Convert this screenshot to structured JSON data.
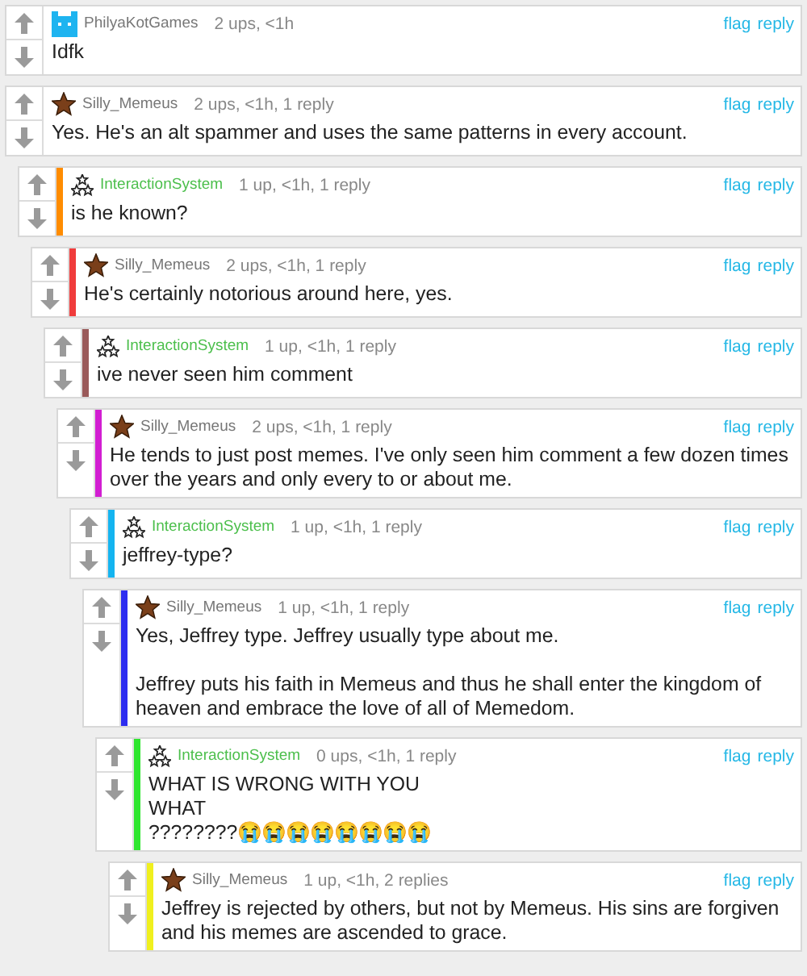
{
  "comments": [
    {
      "author": {
        "name": "PhilyaKotGames",
        "kind": "cat",
        "color": "#777777"
      },
      "meta": "2 ups, <1h",
      "actions": [
        "flag",
        "reply"
      ],
      "paragraphs": [
        [
          "Idfk"
        ]
      ]
    },
    {
      "author": {
        "name": "Silly_Memeus",
        "kind": "star",
        "color": "#777777"
      },
      "meta": "2 ups, <1h, 1 reply",
      "actions": [
        "flag",
        "reply"
      ],
      "paragraphs": [
        [
          "Yes. He's an alt spammer and uses the same patterns in every account."
        ]
      ],
      "children": [
        {
          "author": {
            "name": "InteractionSystem",
            "kind": "stars",
            "color": "#4cbf4c"
          },
          "color": "#ff8c00",
          "meta": "1 up, <1h, 1 reply",
          "actions": [
            "flag",
            "reply"
          ],
          "paragraphs": [
            [
              "is he known?"
            ]
          ],
          "children": [
            {
              "author": {
                "name": "Silly_Memeus",
                "kind": "star",
                "color": "#777777"
              },
              "color": "#f03c3c",
              "meta": "2 ups, <1h, 1 reply",
              "actions": [
                "flag",
                "reply"
              ],
              "paragraphs": [
                [
                  "He's certainly notorious around here, yes."
                ]
              ],
              "children": [
                {
                  "author": {
                    "name": "InteractionSystem",
                    "kind": "stars",
                    "color": "#4cbf4c"
                  },
                  "color": "#9a5a5a",
                  "meta": "1 up, <1h, 1 reply",
                  "actions": [
                    "flag",
                    "reply"
                  ],
                  "paragraphs": [
                    [
                      "ive never seen him comment"
                    ]
                  ],
                  "children": [
                    {
                      "author": {
                        "name": "Silly_Memeus",
                        "kind": "star",
                        "color": "#777777"
                      },
                      "color": "#d21ed2",
                      "meta": "2 ups, <1h, 1 reply",
                      "actions": [
                        "flag",
                        "reply"
                      ],
                      "paragraphs": [
                        [
                          "He tends to just post memes. I've only seen him comment a few dozen times over the years and only every to or about me."
                        ]
                      ],
                      "children": [
                        {
                          "author": {
                            "name": "InteractionSystem",
                            "kind": "stars",
                            "color": "#4cbf4c"
                          },
                          "color": "#14b4f0",
                          "meta": "1 up, <1h, 1 reply",
                          "actions": [
                            "flag",
                            "reply"
                          ],
                          "paragraphs": [
                            [
                              "jeffrey-type?"
                            ]
                          ],
                          "children": [
                            {
                              "author": {
                                "name": "Silly_Memeus",
                                "kind": "star",
                                "color": "#777777"
                              },
                              "color": "#2d2df0",
                              "meta": "1 up, <1h, 1 reply",
                              "actions": [
                                "flag",
                                "reply"
                              ],
                              "paragraphs": [
                                [
                                  "Yes, Jeffrey type. Jeffrey usually type about me."
                                ],
                                [
                                  "Jeffrey puts his faith in Memeus and thus he shall enter the kingdom of heaven and embrace the love of all of Memedom."
                                ]
                              ],
                              "children": [
                                {
                                  "author": {
                                    "name": "InteractionSystem",
                                    "kind": "stars",
                                    "color": "#4cbf4c"
                                  },
                                  "color": "#2ee62e",
                                  "meta": "0 ups, <1h, 1 reply",
                                  "actions": [
                                    "flag",
                                    "reply"
                                  ],
                                  "paragraphs": [
                                    [
                                      "WHAT IS WRONG WITH YOU",
                                      "WHAT",
                                      "????????😭😭😭😭😭😭😭😭"
                                    ]
                                  ],
                                  "children": [
                                    {
                                      "author": {
                                        "name": "Silly_Memeus",
                                        "kind": "star",
                                        "color": "#777777"
                                      },
                                      "color": "#f0f01e",
                                      "meta": "1 up, <1h, 2 replies",
                                      "actions": [
                                        "flag",
                                        "reply"
                                      ],
                                      "paragraphs": [
                                        [
                                          "Jeffrey is rejected by others, but not by Memeus. His sins are forgiven and his memes are ascended to grace."
                                        ]
                                      ]
                                    }
                                  ]
                                }
                              ]
                            }
                          ]
                        }
                      ]
                    }
                  ]
                }
              ]
            }
          ]
        }
      ]
    }
  ]
}
